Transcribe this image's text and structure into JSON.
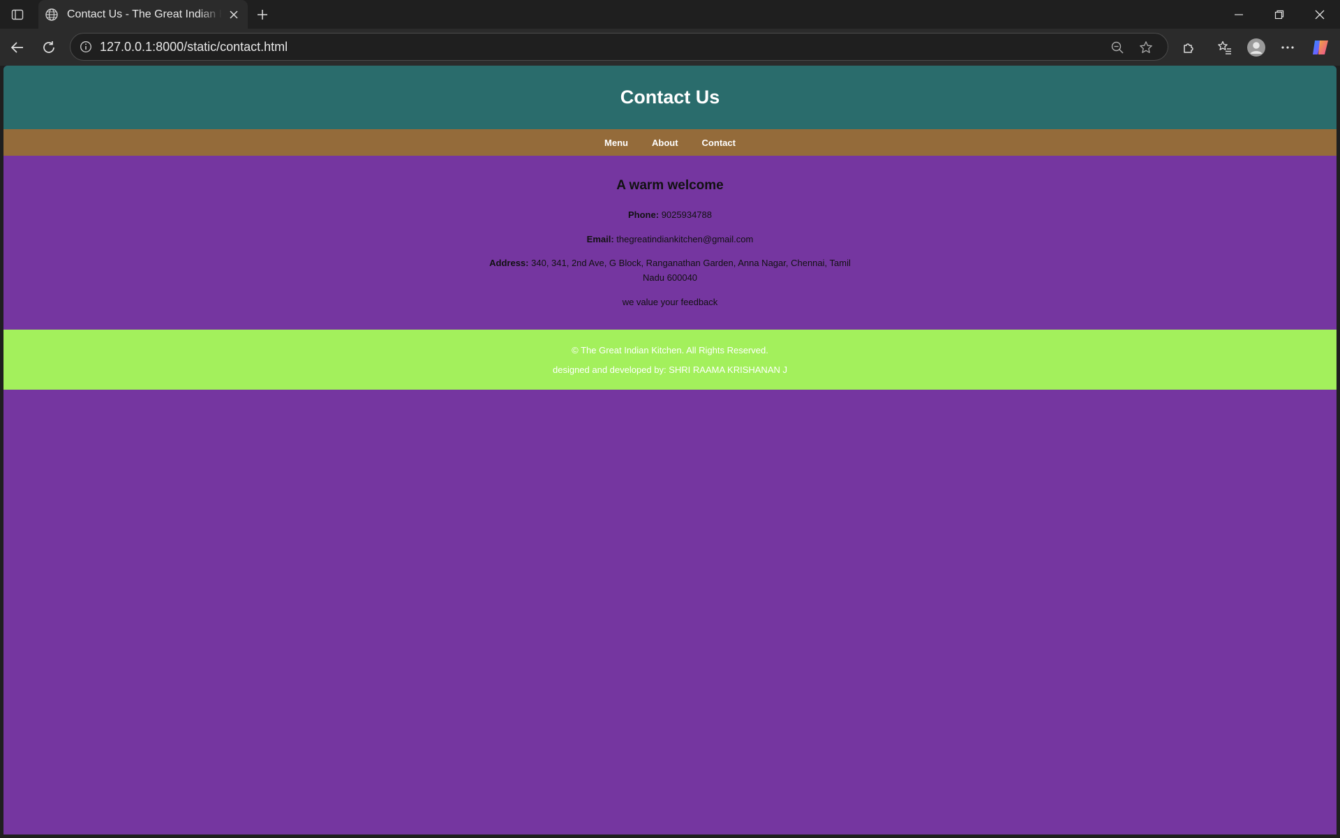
{
  "browser": {
    "tab_title": "Contact Us - The Great Indian Kitchen",
    "url": "127.0.0.1:8000/static/contact.html",
    "icons": [
      "tab-actions-icon",
      "globe-icon",
      "close-icon",
      "plus-icon",
      "minimize-icon",
      "restore-icon",
      "window-close-icon",
      "back-arrow-icon",
      "refresh-icon",
      "info-icon",
      "zoom-out-icon",
      "star-icon",
      "extensions-icon",
      "favorites-icon",
      "profile-icon",
      "more-icon",
      "copilot-icon"
    ]
  },
  "page": {
    "header_title": "Contact Us",
    "nav": [
      {
        "label": "Menu"
      },
      {
        "label": "About"
      },
      {
        "label": "Contact"
      }
    ],
    "welcome": "A warm welcome",
    "phone_label": "Phone:",
    "phone_value": "9025934788",
    "email_label": "Email:",
    "email_value": "thegreatindiankitchen@gmail.com",
    "address_label": "Address:",
    "address_value": "340, 341, 2nd Ave, G Block, Ranganathan Garden, Anna Nagar, Chennai, Tamil Nadu 600040",
    "feedback": "we value your feedback",
    "footer_copy": "© The Great Indian Kitchen. All Rights Reserved.",
    "footer_credit": "designed and developed by: SHRI RAAMA KRISHANAN J"
  },
  "colors": {
    "header_bg": "#2a6c6c",
    "nav_bg": "#946b3a",
    "body_bg": "#7536a0",
    "footer_bg": "#a3f05c"
  }
}
